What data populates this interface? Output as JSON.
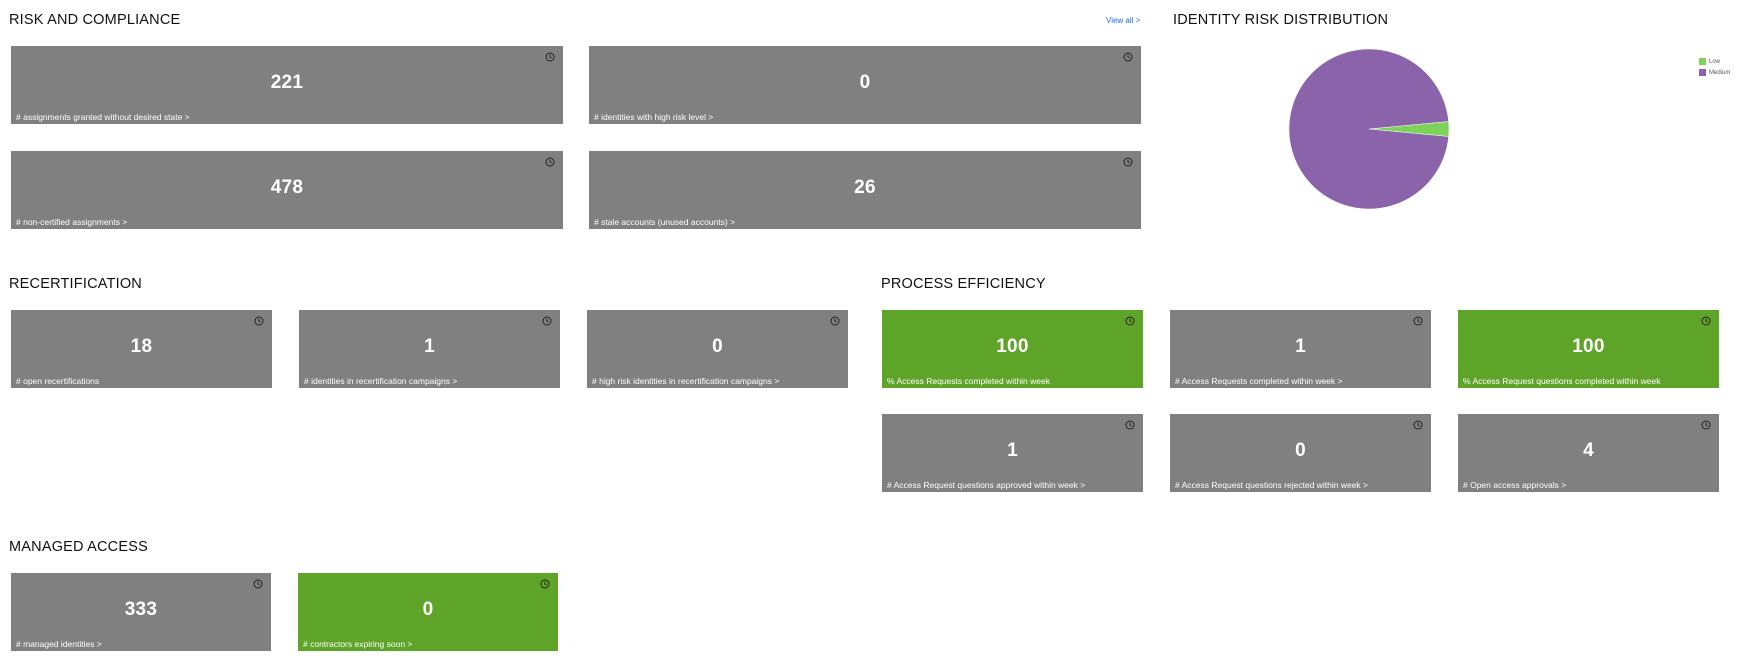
{
  "sections": {
    "risk": {
      "title": "RISK AND COMPLIANCE",
      "view_all": "View all >"
    },
    "identity_risk": {
      "title": "IDENTITY RISK DISTRIBUTION"
    },
    "recert": {
      "title": "RECERTIFICATION"
    },
    "process": {
      "title": "PROCESS EFFICIENCY"
    },
    "managed": {
      "title": "MANAGED ACCESS"
    }
  },
  "tiles": {
    "assignments_no_desired": {
      "value": "221",
      "label": "# assignments granted without desired state >",
      "color": "#808080"
    },
    "high_risk_identities": {
      "value": "0",
      "label": "# identities with high risk level >",
      "color": "#808080"
    },
    "noncertified": {
      "value": "478",
      "label": "# non-certified assignments >",
      "color": "#808080"
    },
    "stale_accounts": {
      "value": "26",
      "label": "# stale accounts (unused accounts) >",
      "color": "#808080"
    },
    "open_recerts": {
      "value": "18",
      "label": "# open recertifications",
      "color": "#808080"
    },
    "identities_in_campaigns": {
      "value": "1",
      "label": "# identities in recertification campaigns >",
      "color": "#808080"
    },
    "high_risk_in_campaigns": {
      "value": "0",
      "label": "# high risk identities in recertification campaigns >",
      "color": "#808080"
    },
    "pct_requests_completed": {
      "value": "100",
      "label": "% Access Requests completed within week",
      "color": "#5ea428"
    },
    "requests_completed": {
      "value": "1",
      "label": "# Access Requests completed within week >",
      "color": "#808080"
    },
    "pct_questions_completed": {
      "value": "100",
      "label": "% Access Request questions completed within week",
      "color": "#5ea428"
    },
    "questions_approved": {
      "value": "1",
      "label": "# Access Request questions approved within week >",
      "color": "#808080"
    },
    "questions_rejected": {
      "value": "0",
      "label": "# Access Request questions rejected within week >",
      "color": "#808080"
    },
    "open_approvals": {
      "value": "4",
      "label": "# Open access approvals >",
      "color": "#808080"
    },
    "managed_identities": {
      "value": "333",
      "label": "# managed identities >",
      "color": "#808080"
    },
    "contractors_expiring": {
      "value": "0",
      "label": "# contractors expiring soon >",
      "color": "#5ea428"
    }
  },
  "chart_data": {
    "type": "pie",
    "title": "",
    "legend_position": "top-right",
    "slices": [
      {
        "name": "Low",
        "value": 3,
        "color": "#7dd35a"
      },
      {
        "name": "Medium",
        "value": 97,
        "color": "#8a63ab"
      }
    ]
  },
  "icons": {
    "tile_corner": "clock-icon"
  }
}
